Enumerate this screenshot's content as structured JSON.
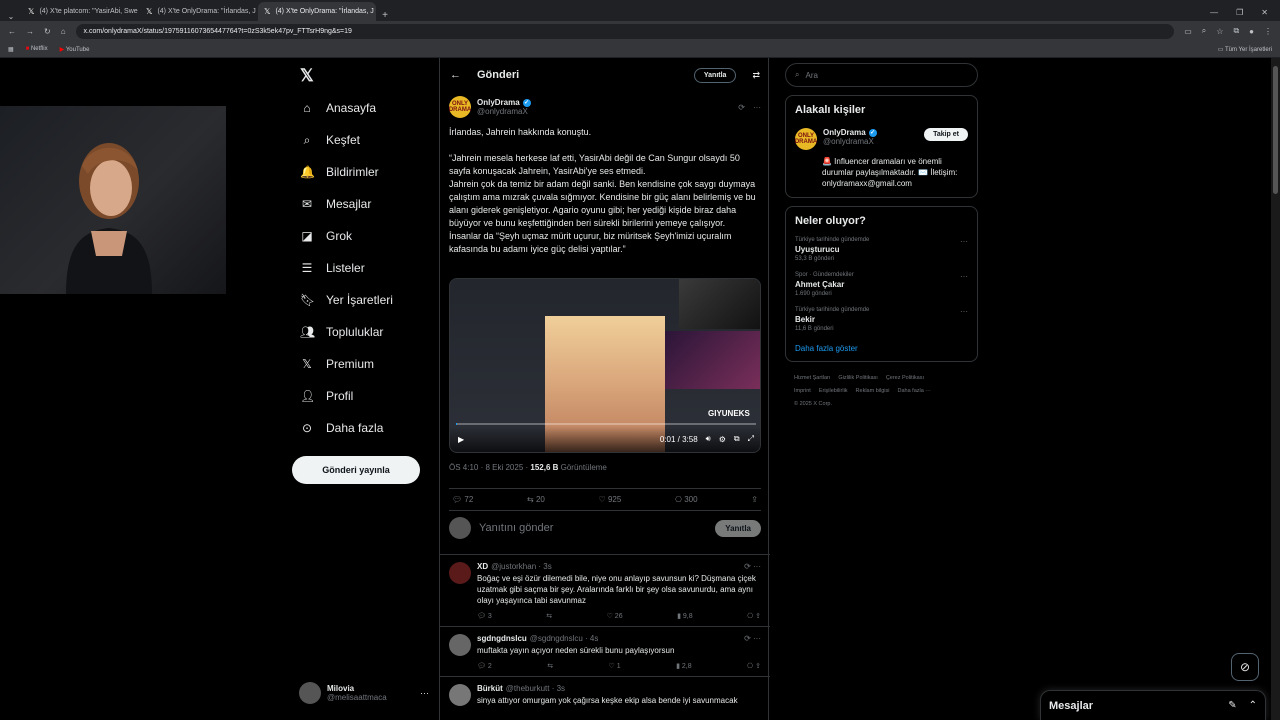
{
  "browser": {
    "tabs": [
      {
        "title": "(4) X'te platcom: \"YasirAbi, Swe"
      },
      {
        "title": "(4) X'te OnlyDrama: \"İrlandas, J"
      },
      {
        "title": "(4) X'te OnlyDrama: \"İrlandas, J"
      }
    ],
    "url": "x.com/onlydramaX/status/1975911607365447764?t=0zS3k5ek47pv_FTTsrH9ng&s=19",
    "bookmarks": [
      "Netflix",
      "YouTube"
    ],
    "all_bookmarks": "Tüm Yer İşaretleri"
  },
  "sidebar": {
    "items": [
      {
        "label": "Anasayfa",
        "icon": "home-icon"
      },
      {
        "label": "Keşfet",
        "icon": "explore-icon"
      },
      {
        "label": "Bildirimler",
        "icon": "bell-icon"
      },
      {
        "label": "Mesajlar",
        "icon": "mail-icon"
      },
      {
        "label": "Grok",
        "icon": "grok-icon"
      },
      {
        "label": "Listeler",
        "icon": "list-icon"
      },
      {
        "label": "Yer İşaretleri",
        "icon": "bookmark-icon"
      },
      {
        "label": "Topluluklar",
        "icon": "people-icon"
      },
      {
        "label": "Premium",
        "icon": "x-icon"
      },
      {
        "label": "Profil",
        "icon": "person-icon"
      },
      {
        "label": "Daha fazla",
        "icon": "more-circle-icon"
      }
    ],
    "post_button": "Gönderi yayınla",
    "account": {
      "name": "Milovia",
      "handle": "@melisaattmaca"
    }
  },
  "main": {
    "title": "Gönderi",
    "reply_button": "Yanıtla",
    "tweet": {
      "author": "OnlyDrama",
      "avatar_text": "ONLY DRAMA",
      "handle": "@onlydramaX",
      "text": "İrlandas, Jahrein hakkında konuştu.\n\n“Jahrein mesela herkese laf etti, YasirAbi değil de Can Sungur olsaydı 50 sayfa konuşacak Jahrein, YasirAbi'ye ses etmedi.\nJahrein çok da temiz bir adam değil sanki. Ben kendisine çok saygı duymaya çalıştım ama mızrak çuvala sığmıyor. Kendisine bir güç alanı belirlemiş ve bu alanı giderek genişletiyor. Agario oyunu gibi; her yediği kişide biraz daha büyüyor ve bunu keşfettiğinden beri sürekli birilerini yemeye çalışıyor.\nİnsanlar da “Şeyh uçmaz mürit uçurur, biz müritsek Şeyh'imizi uçuralım kafasında bu adamı iyice güç delisi yaptılar.”",
      "video_time": "0:01 / 3:58",
      "video_progress": 0.004,
      "video_watermark": "GIYUNEKS",
      "timestamp": "ÖS 4:10 · 8 Eki 2025 · ",
      "views": "152,6 B",
      "views_label": " Görüntüleme",
      "replies": "72",
      "reposts": "20",
      "likes": "925",
      "bookmarks": "300"
    },
    "reply_placeholder": "Yanıtını gönder",
    "reply_submit": "Yanıtla",
    "replies": [
      {
        "name": "XD",
        "handle": "@justorkhan · 3s",
        "text": "Boğaç ve eşi özür dilemedi bile, niye onu anlayıp savunsun ki? Düşmana çiçek uzatmak gibi saçma bir şey. Aralarında farklı bir şey olsa savunurdu, ama aynı olayı yaşayınca tabi savunmaz",
        "replies": "3",
        "reposts": "",
        "likes": "26",
        "views": "9,8"
      },
      {
        "name": "sgdngdnslcu",
        "handle": "@sgdngdnslcu · 4s",
        "text": "muftakta yayın açıyor neden sürekli bunu paylaşıyorsun",
        "replies": "2",
        "reposts": "",
        "likes": "1",
        "views": "2,8"
      },
      {
        "name": "Bürküt",
        "handle": "@theburkutt · 3s",
        "text": "sinya attıyor omurgam yok çağırsa keşke ekip alsa bende iyi savunmacak",
        "replies": "",
        "reposts": "",
        "likes": "",
        "views": ""
      }
    ]
  },
  "right": {
    "search_placeholder": "Ara",
    "related_title": "Alakalı kişiler",
    "related": {
      "name": "OnlyDrama",
      "handle": "@onlydramaX",
      "follow": "Takip et",
      "bio": "🚨 Influencer dramaları ve önemli durumlar paylaşılmaktadır. ✉️ İletişim: onlydramaxx@gmail.com"
    },
    "trends_title": "Neler oluyor?",
    "trends": [
      {
        "category": "Türkiye tarihinde gündemde",
        "name": "Uyuşturucu",
        "count": "53,3 B gönderi"
      },
      {
        "category": "Spor · Gündemdekiler",
        "name": "Ahmet Çakar",
        "count": "1.690 gönderi"
      },
      {
        "category": "Türkiye tarihinde gündemde",
        "name": "Bekir",
        "count": "11,6 B gönderi"
      }
    ],
    "show_more": "Daha fazla göster",
    "footer": [
      "Hizmet Şartları",
      "Gizlilik Politikası",
      "Çerez Politikası",
      "Imprint",
      "Erişilebilirlik",
      "Reklam bilgisi",
      "Daha fazla ···",
      "© 2025 X Corp."
    ]
  },
  "messages_drawer": {
    "title": "Mesajlar"
  },
  "colors": {
    "accent": "#1d9bf0",
    "background": "#000000",
    "border": "#2f3336",
    "muted": "#71767b"
  }
}
